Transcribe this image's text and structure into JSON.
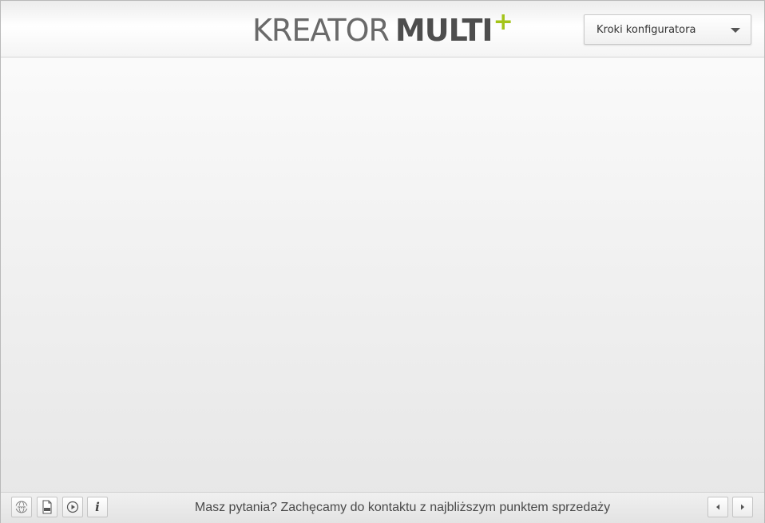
{
  "header": {
    "logo_light": "KREATOR",
    "logo_bold": "MULTI",
    "logo_plus": "+",
    "dropdown_label": "Kroki konfiguratora"
  },
  "footer": {
    "message": "Masz pytania? Zachęcamy do kontaktu z najbliższym punktem sprzedaży",
    "buttons": [
      {
        "icon": "www-globe-icon"
      },
      {
        "icon": "pdf-document-icon"
      },
      {
        "icon": "play-icon"
      },
      {
        "icon": "info-icon",
        "glyph": "i"
      }
    ],
    "nav": [
      {
        "icon": "arrow-left-icon"
      },
      {
        "icon": "arrow-right-icon"
      }
    ]
  },
  "colors": {
    "accent_plus": "#a4c419",
    "logo_text": "#5a5a5a"
  }
}
